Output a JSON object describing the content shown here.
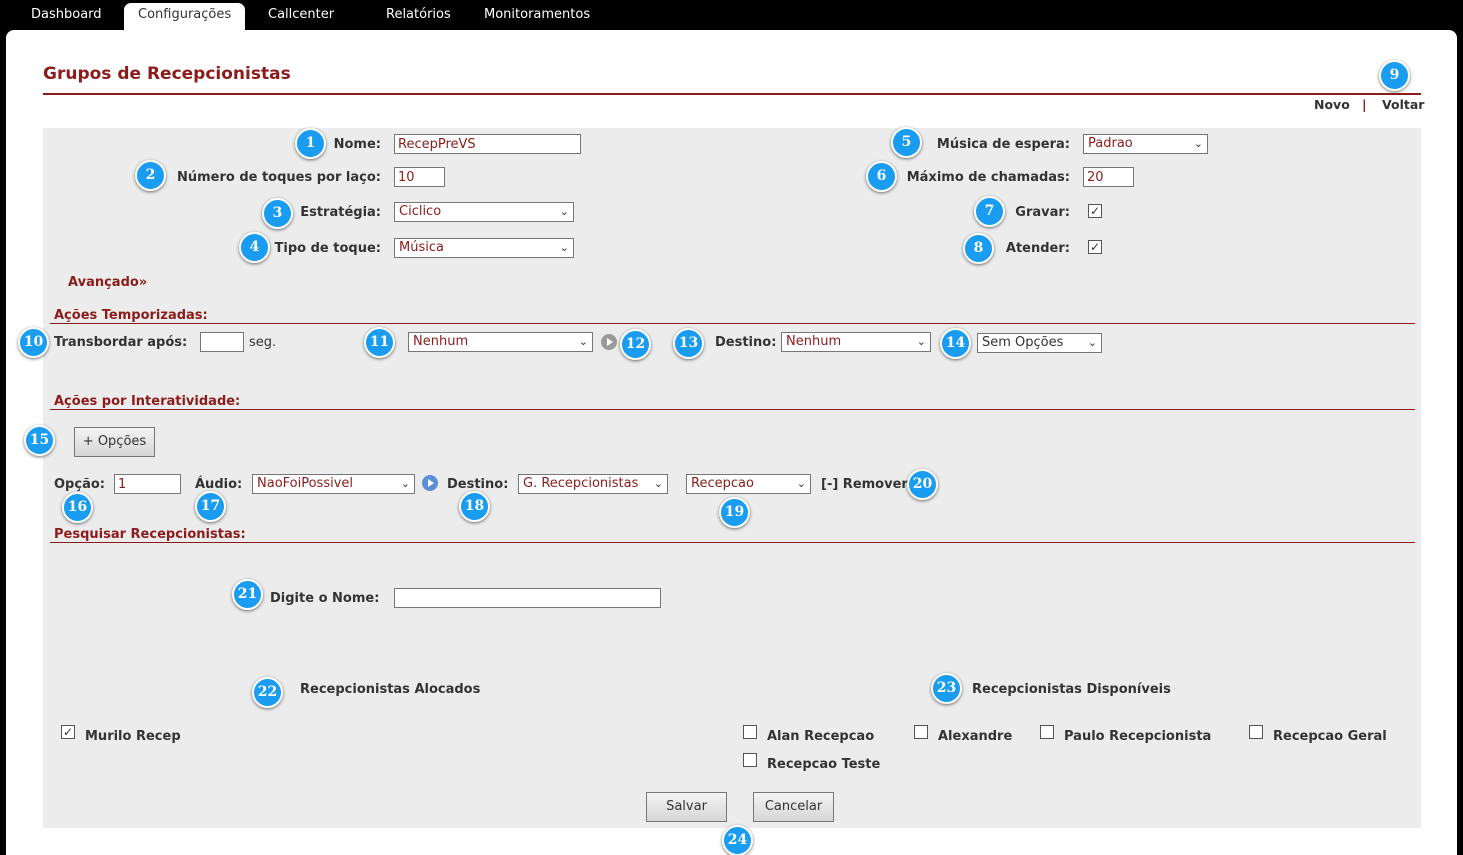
{
  "nav": {
    "tabs": [
      {
        "label": "Dashboard"
      },
      {
        "label": "Configurações"
      },
      {
        "label": "Callcenter"
      },
      {
        "label": "Relatórios"
      },
      {
        "label": "Monitoramentos"
      }
    ],
    "active_tab": "Configurações"
  },
  "page": {
    "title": "Grupos de Recepcionistas",
    "links": {
      "new": "Novo",
      "separator": "|",
      "back": "Voltar"
    }
  },
  "form": {
    "nome": {
      "label": "Nome:",
      "value": "RecepPreVS"
    },
    "toques": {
      "label": "Número de toques por laço:",
      "value": "10"
    },
    "estrategia": {
      "label": "Estratégia:",
      "value": "Ciclico"
    },
    "tipo_toque": {
      "label": "Tipo de toque:",
      "value": "Música"
    },
    "musica_espera": {
      "label": "Música de espera:",
      "value": "Padrao"
    },
    "max_chamadas": {
      "label": "Máximo de chamadas:",
      "value": "20"
    },
    "gravar": {
      "label": "Gravar:",
      "checked": true
    },
    "atender": {
      "label": "Atender:",
      "checked": true
    },
    "advanced_link": "Avançado»"
  },
  "timed_actions": {
    "title": "Ações Temporizadas:",
    "overflow_label": "Transbordar após:",
    "overflow_value": "",
    "unit": "seg.",
    "action_value": "Nenhum",
    "dest_label": "Destino:",
    "dest_value": "Nenhum",
    "options_value": "Sem Opções"
  },
  "interactive_actions": {
    "title": "Ações por Interatividade:",
    "add_button": "+ Opções",
    "option_label": "Opção:",
    "option_value": "1",
    "audio_label": "Áudio:",
    "audio_value": "NaoFoiPossivel",
    "dest_label": "Destino:",
    "dest_value": "G. Recepcionistas",
    "target_value": "Recepcao",
    "remove_label": "[-] Remover"
  },
  "search": {
    "title": "Pesquisar Recepcionistas:",
    "name_label": "Digite o Nome:",
    "name_value": ""
  },
  "allocated": {
    "title": "Recepcionistas Alocados",
    "items": [
      {
        "name": "Murilo Recep",
        "checked": true
      }
    ]
  },
  "available": {
    "title": "Recepcionistas Disponíveis",
    "items": [
      {
        "name": "Alan Recepcao",
        "checked": false
      },
      {
        "name": "Alexandre",
        "checked": false
      },
      {
        "name": "Paulo Recepcionista",
        "checked": false
      },
      {
        "name": "Recepcao Geral",
        "checked": false
      },
      {
        "name": "Recepcao Teste",
        "checked": false
      }
    ]
  },
  "buttons": {
    "save": "Salvar",
    "cancel": "Cancelar"
  },
  "badges": [
    "1",
    "2",
    "3",
    "4",
    "5",
    "6",
    "7",
    "8",
    "9",
    "10",
    "11",
    "12",
    "13",
    "14",
    "15",
    "16",
    "17",
    "18",
    "19",
    "20",
    "21",
    "22",
    "23",
    "24"
  ],
  "colors": {
    "accent": "#8b1c1c",
    "badge": "#1a9cf0",
    "form_bg": "#ececec"
  }
}
